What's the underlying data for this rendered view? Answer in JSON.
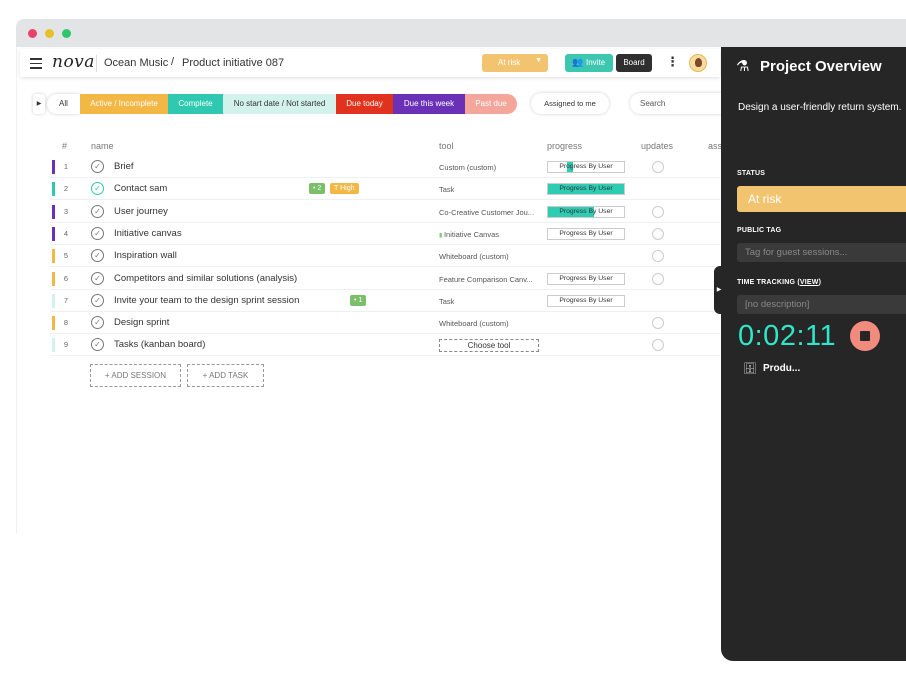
{
  "header": {
    "logo": "nova",
    "breadcrumb_project": "Ocean Music",
    "breadcrumb_sep": "/",
    "breadcrumb_item": "Product initiative 087",
    "status_label": "At risk",
    "invite_label": "Invite",
    "board_label": "Board"
  },
  "filters": {
    "chips": [
      {
        "label": "All",
        "bg": "#ffffff",
        "color": "#333333"
      },
      {
        "label": "Active / Incomplete",
        "bg": "#f3b745",
        "color": "#ffffff"
      },
      {
        "label": "Complete",
        "bg": "#2ec9b0",
        "color": "#ffffff"
      },
      {
        "label": "No start date / Not started",
        "bg": "#d4f2ec",
        "color": "#333333"
      },
      {
        "label": "Due today",
        "bg": "#e0321d",
        "color": "#ffffff"
      },
      {
        "label": "Due this week",
        "bg": "#6a31b7",
        "color": "#ffffff"
      },
      {
        "label": "Past due",
        "bg": "#f4a69b",
        "color": "#ffffff"
      }
    ],
    "assigned_label": "Assigned to me",
    "search_placeholder": "Search"
  },
  "table": {
    "columns": {
      "num": "#",
      "name": "name",
      "tool": "tool",
      "progress": "progress",
      "updates": "updates",
      "assignee": "ass"
    },
    "rows": [
      {
        "num": "1",
        "name": "Brief",
        "tool": "Custom (custom)",
        "progress_label": "Progress By User",
        "progress": 0.5,
        "bar_color": "#6a31b7",
        "complete": false,
        "updates": true
      },
      {
        "num": "2",
        "name": "Contact sam",
        "tool": "Task",
        "progress_label": "Progress By User",
        "progress": 1.0,
        "bar_color": "#2ec9b0",
        "complete": true,
        "updates": false,
        "badge_count": "2",
        "badge_priority": "High"
      },
      {
        "num": "3",
        "name": "User journey",
        "tool": "Co-Creative Customer Jou...",
        "progress_label": "Progress By User",
        "progress": 0.6,
        "bar_color": "#6a31b7",
        "complete": false,
        "updates": true
      },
      {
        "num": "4",
        "name": "Initiative canvas",
        "tool": "Initiative Canvas",
        "progress_label": "Progress By User",
        "progress": 0,
        "bar_color": "#6a31b7",
        "complete": false,
        "updates": true
      },
      {
        "num": "5",
        "name": "Inspiration wall",
        "tool": "Whiteboard (custom)",
        "progress_label": "",
        "progress": 0,
        "bar_color": "#f3b745",
        "complete": false,
        "updates": true
      },
      {
        "num": "6",
        "name": "Competitors and similar solutions (analysis)",
        "tool": "Feature Comparison Canv...",
        "progress_label": "Progress By User",
        "progress": 0,
        "bar_color": "#f3b745",
        "complete": false,
        "updates": true
      },
      {
        "num": "7",
        "name": "Invite your team to the design sprint session",
        "tool": "Task",
        "progress_label": "Progress By User",
        "progress": 0,
        "bar_color": "#d4f2ec",
        "complete": false,
        "updates": false,
        "badge_count": "1"
      },
      {
        "num": "8",
        "name": "Design sprint",
        "tool": "Whiteboard (custom)",
        "progress_label": "",
        "progress": 0,
        "bar_color": "#f3b745",
        "complete": false,
        "updates": true
      },
      {
        "num": "9",
        "name": "Tasks (kanban board)",
        "tool": "",
        "progress_label": "",
        "progress": 0,
        "bar_color": "#d4f2ec",
        "complete": false,
        "updates": true
      }
    ],
    "choose_tool_label": "Choose tool",
    "add_session_label": "+ ADD SESSION",
    "add_task_label": "+ ADD TASK"
  },
  "panel": {
    "title": "Project Overview",
    "description": "Design a user-friendly return system.",
    "status_heading": "STATUS",
    "status_value": "At risk",
    "public_tag_heading": "PUBLIC TAG",
    "public_tag_placeholder": "Tag for guest sessions...",
    "time_tracking_heading": "TIME TRACKING (",
    "time_tracking_link": "VIEW",
    "time_tracking_close": ")",
    "time_description_placeholder": "[no description]",
    "timer": "0:02:11",
    "project_short": "Produ..."
  }
}
